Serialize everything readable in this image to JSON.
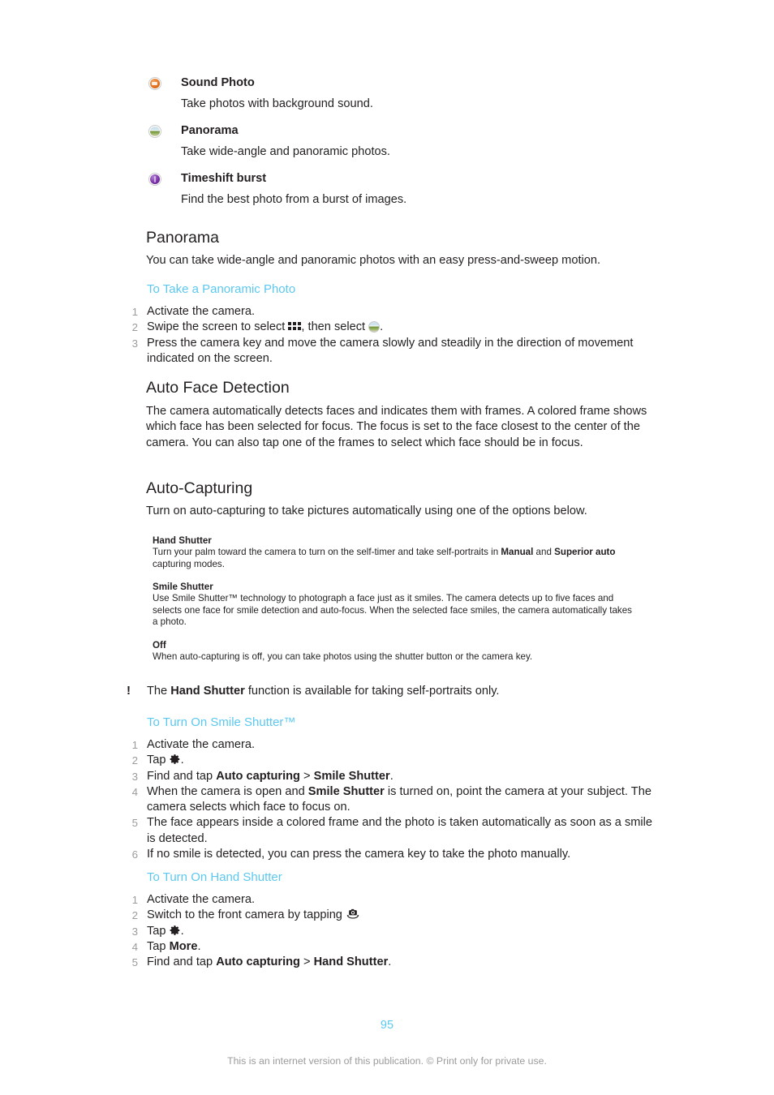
{
  "document": {
    "page_number": "95",
    "footer_note": "This is an internet version of this publication. © Print only for private use.",
    "accent_color": "#5cc8f0",
    "text_color": "#231f20",
    "list_number_color": "#9b9b9b"
  },
  "modes": [
    {
      "icon": "sound-photo-icon",
      "icon_color": "#e2701d",
      "title": "Sound Photo",
      "description": "Take photos with background sound."
    },
    {
      "icon": "panorama-icon",
      "icon_color": "#6c8f3a",
      "title": "Panorama",
      "description": "Take wide-angle and panoramic photos."
    },
    {
      "icon": "timeshift-burst-icon",
      "icon_color": "#7b2fa8",
      "title": "Timeshift burst",
      "description": "Find the best photo from a burst of images."
    }
  ],
  "sections": {
    "panorama": {
      "heading": "Panorama",
      "intro": "You can take wide-angle and panoramic photos with an easy press-and-sweep motion.",
      "procedure_heading": "To Take a Panoramic Photo",
      "steps": [
        {
          "num": "1",
          "text": "Activate the camera."
        },
        {
          "num": "2",
          "prefix": "Swipe the screen to select ",
          "icon1": "apps-grid-icon",
          "middle": ", then select ",
          "icon2": "panorama-icon",
          "suffix": "."
        },
        {
          "num": "3",
          "text": "Press the camera key and move the camera slowly and steadily in the direction of movement indicated on the screen."
        }
      ]
    },
    "auto_face_detection": {
      "heading": "Auto Face Detection",
      "body": "The camera automatically detects faces and indicates them with frames. A colored frame shows which face has been selected for focus. The focus is set to the face closest to the center of the camera. You can also tap one of the frames to select which face should be in focus."
    },
    "auto_capturing": {
      "heading": "Auto-Capturing",
      "intro": "Turn on auto-capturing to take pictures automatically using one of the options below.",
      "options": [
        {
          "title": "Hand Shutter",
          "body_part1": "Turn your palm toward the camera to turn on the self-timer and take self-portraits in ",
          "bold1": "Manual",
          "body_part2": " and ",
          "bold2": "Superior auto",
          "body_part3": " capturing modes."
        },
        {
          "title": "Smile Shutter",
          "body_part1": "Use Smile Shutter™ technology to photograph a face just as it smiles. The camera detects up to five faces and selects one face for smile detection and auto-focus. When the selected face smiles, the camera automatically takes a photo.",
          "bold1": "",
          "body_part2": "",
          "bold2": "",
          "body_part3": ""
        },
        {
          "title": "Off",
          "body_part1": "When auto-capturing is off, you can take photos using the shutter button or the camera key.",
          "bold1": "",
          "body_part2": "",
          "bold2": "",
          "body_part3": ""
        }
      ],
      "note": {
        "icon": "exclamation-icon",
        "glyph": "!",
        "prefix": "The ",
        "bold": "Hand Shutter",
        "suffix": " function is available for taking self-portraits only."
      },
      "smile_shutter": {
        "procedure_heading": "To Turn On Smile Shutter™",
        "steps": [
          {
            "num": "1",
            "text": "Activate the camera."
          },
          {
            "num": "2",
            "prefix": "Tap ",
            "icon1": "gear-icon",
            "suffix": "."
          },
          {
            "num": "3",
            "prefix": "Find and tap ",
            "bold1": "Auto capturing",
            "middle": " > ",
            "bold2": "Smile Shutter",
            "suffix": "."
          },
          {
            "num": "4",
            "prefix": "When the camera is open and ",
            "bold1": "Smile Shutter",
            "suffix": " is turned on, point the camera at your subject. The camera selects which face to focus on."
          },
          {
            "num": "5",
            "text": "The face appears inside a colored frame and the photo is taken automatically as soon as a smile is detected."
          },
          {
            "num": "6",
            "text": "If no smile is detected, you can press the camera key to take the photo manually."
          }
        ]
      },
      "hand_shutter": {
        "procedure_heading": "To Turn On Hand Shutter",
        "steps": [
          {
            "num": "1",
            "text": "Activate the camera."
          },
          {
            "num": "2",
            "prefix": "Switch to the front camera by tapping ",
            "icon1": "camera-switch-icon",
            "suffix": ""
          },
          {
            "num": "3",
            "prefix": "Tap ",
            "icon1": "gear-icon",
            "suffix": "."
          },
          {
            "num": "4",
            "prefix": "Tap ",
            "bold1": "More",
            "suffix": "."
          },
          {
            "num": "5",
            "prefix": "Find and tap ",
            "bold1": "Auto capturing",
            "middle": " > ",
            "bold2": "Hand Shutter",
            "suffix": "."
          }
        ]
      }
    }
  }
}
